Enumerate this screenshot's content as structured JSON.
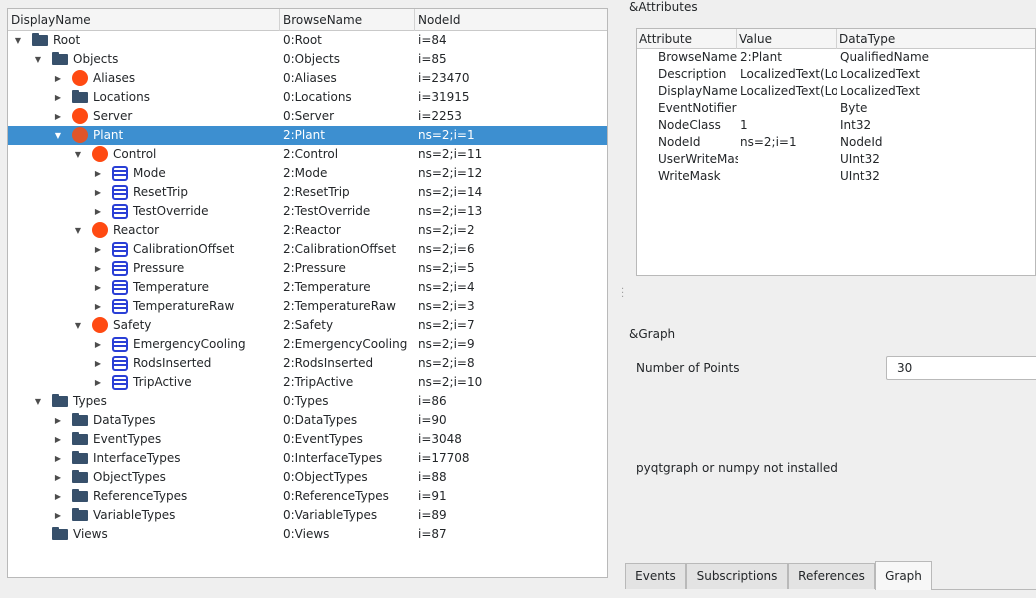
{
  "tree": {
    "columns": [
      "DisplayName",
      "BrowseName",
      "NodeId"
    ],
    "rows": [
      {
        "level": 0,
        "arrow": "down",
        "icon": "folder",
        "name": "Root",
        "browse": "0:Root",
        "node": "i=84"
      },
      {
        "level": 1,
        "arrow": "down",
        "icon": "folder",
        "name": "Objects",
        "browse": "0:Objects",
        "node": "i=85"
      },
      {
        "level": 2,
        "arrow": "right",
        "icon": "object",
        "name": "Aliases",
        "browse": "0:Aliases",
        "node": "i=23470"
      },
      {
        "level": 2,
        "arrow": "right",
        "icon": "folder",
        "name": "Locations",
        "browse": "0:Locations",
        "node": "i=31915"
      },
      {
        "level": 2,
        "arrow": "right",
        "icon": "object",
        "name": "Server",
        "browse": "0:Server",
        "node": "i=2253"
      },
      {
        "level": 2,
        "arrow": "down",
        "icon": "object",
        "name": "Plant",
        "browse": "2:Plant",
        "node": "ns=2;i=1",
        "selected": true
      },
      {
        "level": 3,
        "arrow": "down",
        "icon": "object",
        "name": "Control",
        "browse": "2:Control",
        "node": "ns=2;i=11"
      },
      {
        "level": 4,
        "arrow": "right",
        "icon": "variable",
        "name": "Mode",
        "browse": "2:Mode",
        "node": "ns=2;i=12"
      },
      {
        "level": 4,
        "arrow": "right",
        "icon": "variable",
        "name": "ResetTrip",
        "browse": "2:ResetTrip",
        "node": "ns=2;i=14"
      },
      {
        "level": 4,
        "arrow": "right",
        "icon": "variable",
        "name": "TestOverride",
        "browse": "2:TestOverride",
        "node": "ns=2;i=13"
      },
      {
        "level": 3,
        "arrow": "down",
        "icon": "object",
        "name": "Reactor",
        "browse": "2:Reactor",
        "node": "ns=2;i=2"
      },
      {
        "level": 4,
        "arrow": "right",
        "icon": "variable",
        "name": "CalibrationOffset",
        "browse": "2:CalibrationOffset",
        "node": "ns=2;i=6"
      },
      {
        "level": 4,
        "arrow": "right",
        "icon": "variable",
        "name": "Pressure",
        "browse": "2:Pressure",
        "node": "ns=2;i=5"
      },
      {
        "level": 4,
        "arrow": "right",
        "icon": "variable",
        "name": "Temperature",
        "browse": "2:Temperature",
        "node": "ns=2;i=4"
      },
      {
        "level": 4,
        "arrow": "right",
        "icon": "variable",
        "name": "TemperatureRaw",
        "browse": "2:TemperatureRaw",
        "node": "ns=2;i=3"
      },
      {
        "level": 3,
        "arrow": "down",
        "icon": "object",
        "name": "Safety",
        "browse": "2:Safety",
        "node": "ns=2;i=7"
      },
      {
        "level": 4,
        "arrow": "right",
        "icon": "variable",
        "name": "EmergencyCooling",
        "browse": "2:EmergencyCooling",
        "node": "ns=2;i=9"
      },
      {
        "level": 4,
        "arrow": "right",
        "icon": "variable",
        "name": "RodsInserted",
        "browse": "2:RodsInserted",
        "node": "ns=2;i=8"
      },
      {
        "level": 4,
        "arrow": "right",
        "icon": "variable",
        "name": "TripActive",
        "browse": "2:TripActive",
        "node": "ns=2;i=10"
      },
      {
        "level": 1,
        "arrow": "down",
        "icon": "folder",
        "name": "Types",
        "browse": "0:Types",
        "node": "i=86"
      },
      {
        "level": 2,
        "arrow": "right",
        "icon": "folder",
        "name": "DataTypes",
        "browse": "0:DataTypes",
        "node": "i=90"
      },
      {
        "level": 2,
        "arrow": "right",
        "icon": "folder",
        "name": "EventTypes",
        "browse": "0:EventTypes",
        "node": "i=3048"
      },
      {
        "level": 2,
        "arrow": "right",
        "icon": "folder",
        "name": "InterfaceTypes",
        "browse": "0:InterfaceTypes",
        "node": "i=17708"
      },
      {
        "level": 2,
        "arrow": "right",
        "icon": "folder",
        "name": "ObjectTypes",
        "browse": "0:ObjectTypes",
        "node": "i=88"
      },
      {
        "level": 2,
        "arrow": "right",
        "icon": "folder",
        "name": "ReferenceTypes",
        "browse": "0:ReferenceTypes",
        "node": "i=91"
      },
      {
        "level": 2,
        "arrow": "right",
        "icon": "folder",
        "name": "VariableTypes",
        "browse": "0:VariableTypes",
        "node": "i=89"
      },
      {
        "level": 1,
        "arrow": "none",
        "icon": "folder",
        "name": "Views",
        "browse": "0:Views",
        "node": "i=87"
      }
    ]
  },
  "attributes": {
    "title": "&Attributes",
    "columns": [
      "Attribute",
      "Value",
      "DataType"
    ],
    "rows": [
      {
        "attribute": "BrowseName",
        "value": "2:Plant",
        "datatype": "QualifiedName"
      },
      {
        "attribute": "Description",
        "value": "LocalizedText(Loc",
        "datatype": "LocalizedText"
      },
      {
        "attribute": "DisplayName",
        "value": "LocalizedText(Loc",
        "datatype": "LocalizedText"
      },
      {
        "attribute": "EventNotifier",
        "value": "",
        "datatype": "Byte"
      },
      {
        "attribute": "NodeClass",
        "value": "1",
        "datatype": "Int32"
      },
      {
        "attribute": "NodeId",
        "value": "ns=2;i=1",
        "datatype": "NodeId"
      },
      {
        "attribute": "UserWriteMas",
        "value": "",
        "datatype": "UInt32"
      },
      {
        "attribute": "WriteMask",
        "value": "",
        "datatype": "UInt32"
      }
    ]
  },
  "graph": {
    "title": "&Graph",
    "points_label": "Number of Points",
    "points_value": "30",
    "message": "pyqtgraph or numpy not installed"
  },
  "tabs": [
    {
      "label": "Events",
      "active": false
    },
    {
      "label": "Subscriptions",
      "active": false
    },
    {
      "label": "References",
      "active": false
    },
    {
      "label": "Graph",
      "active": true
    }
  ],
  "colors": {
    "selection": "#3d8fd0",
    "object_icon": "#ff4a12",
    "variable_icon": "#2a3fd6",
    "folder_icon": "#37506b"
  },
  "icons": {
    "folder": "folder-icon",
    "object": "object-icon",
    "variable": "variable-icon",
    "expanded": "chevron-down-icon",
    "collapsed": "chevron-right-icon"
  }
}
